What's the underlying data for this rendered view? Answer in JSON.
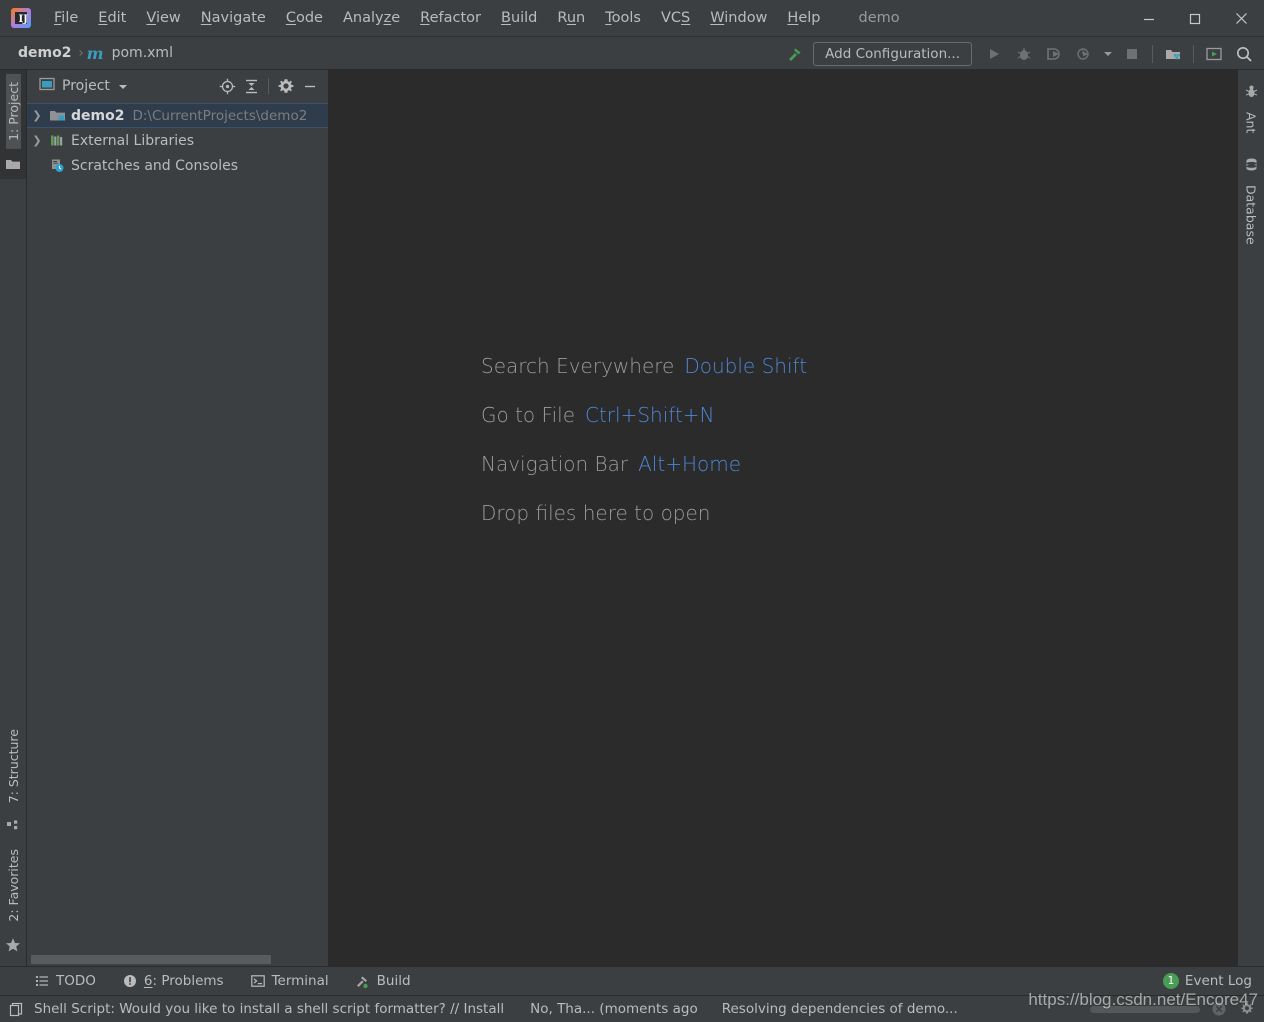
{
  "window": {
    "project_title": "demo",
    "minimize_label": "Minimize",
    "maximize_label": "Maximize",
    "close_label": "Close"
  },
  "menu": {
    "items": [
      {
        "label": "File",
        "mnemonic_index": 0
      },
      {
        "label": "Edit",
        "mnemonic_index": 0
      },
      {
        "label": "View",
        "mnemonic_index": 0
      },
      {
        "label": "Navigate",
        "mnemonic_index": 0
      },
      {
        "label": "Code",
        "mnemonic_index": 0
      },
      {
        "label": "Analyze",
        "mnemonic_index": 5
      },
      {
        "label": "Refactor",
        "mnemonic_index": 0
      },
      {
        "label": "Build",
        "mnemonic_index": 0
      },
      {
        "label": "Run",
        "mnemonic_index": 1
      },
      {
        "label": "Tools",
        "mnemonic_index": 0
      },
      {
        "label": "VCS",
        "mnemonic_index": 2
      },
      {
        "label": "Window",
        "mnemonic_index": 0
      },
      {
        "label": "Help",
        "mnemonic_index": 0
      }
    ]
  },
  "navbar": {
    "breadcrumb": {
      "project": "demo2",
      "separator": "›",
      "file_icon": "m",
      "file": "pom.xml"
    },
    "build_icon_label": "Build",
    "add_configuration_label": "Add Configuration...",
    "run_label": "Run",
    "debug_label": "Debug",
    "run_with_coverage_label": "Run with Coverage",
    "profile_label": "Profile",
    "stop_label": "Stop",
    "project_structure_label": "Project Structure",
    "updates_label": "Updates",
    "search_label": "Search Everywhere"
  },
  "left_stripe": {
    "top_tools": [
      {
        "label": "1: Project",
        "active": true
      }
    ],
    "top_icon": "folder-icon",
    "bottom_tools": [
      {
        "label": "7: Structure",
        "icon": "structure-icon"
      },
      {
        "label": "2: Favorites",
        "icon": "star-icon"
      }
    ]
  },
  "right_stripe": {
    "tools": [
      {
        "label": "Ant",
        "icon": "ant-icon"
      },
      {
        "label": "Database",
        "icon": "database-icon"
      }
    ]
  },
  "project_panel": {
    "header_title": "Project",
    "header_icon": "project-view-icon",
    "dropdown_icon": "chevron-down-icon",
    "actions": [
      {
        "name": "select-opened-file",
        "icon": "target-icon"
      },
      {
        "name": "collapse-all",
        "icon": "collapse-all-icon"
      },
      {
        "name": "settings",
        "icon": "gear-icon"
      },
      {
        "name": "hide",
        "icon": "minimize-icon"
      }
    ],
    "tree": [
      {
        "label": "demo2",
        "path": "D:\\CurrentProjects\\demo2",
        "icon": "module-folder-icon",
        "expandable": true,
        "selected": true,
        "bold": true,
        "indent": 0
      },
      {
        "label": "External Libraries",
        "path": "",
        "icon": "library-icon",
        "expandable": true,
        "selected": false,
        "bold": false,
        "indent": 0
      },
      {
        "label": "Scratches and Consoles",
        "path": "",
        "icon": "scratches-icon",
        "expandable": false,
        "selected": false,
        "bold": false,
        "indent": 0
      }
    ]
  },
  "editor": {
    "hints": [
      {
        "label": "Search Everywhere",
        "key": "Double Shift"
      },
      {
        "label": "Go to File",
        "key": "Ctrl+Shift+N"
      },
      {
        "label": "Navigation Bar",
        "key": "Alt+Home"
      },
      {
        "label": "Drop files here to open",
        "key": ""
      }
    ]
  },
  "bottom_bar": {
    "tools": [
      {
        "label": "TODO",
        "icon": "todo-list-icon"
      },
      {
        "label": "6: Problems",
        "icon": "problems-icon",
        "mnemonic_index": 0
      },
      {
        "label": "Terminal",
        "icon": "terminal-icon"
      },
      {
        "label": "Build",
        "icon": "build-hammer-icon"
      }
    ],
    "event_log": {
      "label": "Event Log",
      "count": "1"
    }
  },
  "status_bar": {
    "icon": "notification-icon",
    "message": "Shell Script: Would you like to install a shell script formatter? // Install",
    "action": "No, Tha... (moments ago",
    "task": "Resolving dependencies of demo...",
    "progress_percent": 45,
    "stop_icon": "stop-circle-icon",
    "settings_icon": "settings-gear-icon"
  },
  "watermark": {
    "text": "https://blog.csdn.net/Encore47"
  },
  "colors": {
    "background": "#3c3f41",
    "editor_background": "#2b2b2b",
    "text": "#bbbbbb",
    "muted_text": "#7d7d7d",
    "accent_blue": "#4d87d6",
    "selection": "#2e3c4b",
    "green": "#499c54",
    "maven_teal": "#3b9dbd"
  }
}
